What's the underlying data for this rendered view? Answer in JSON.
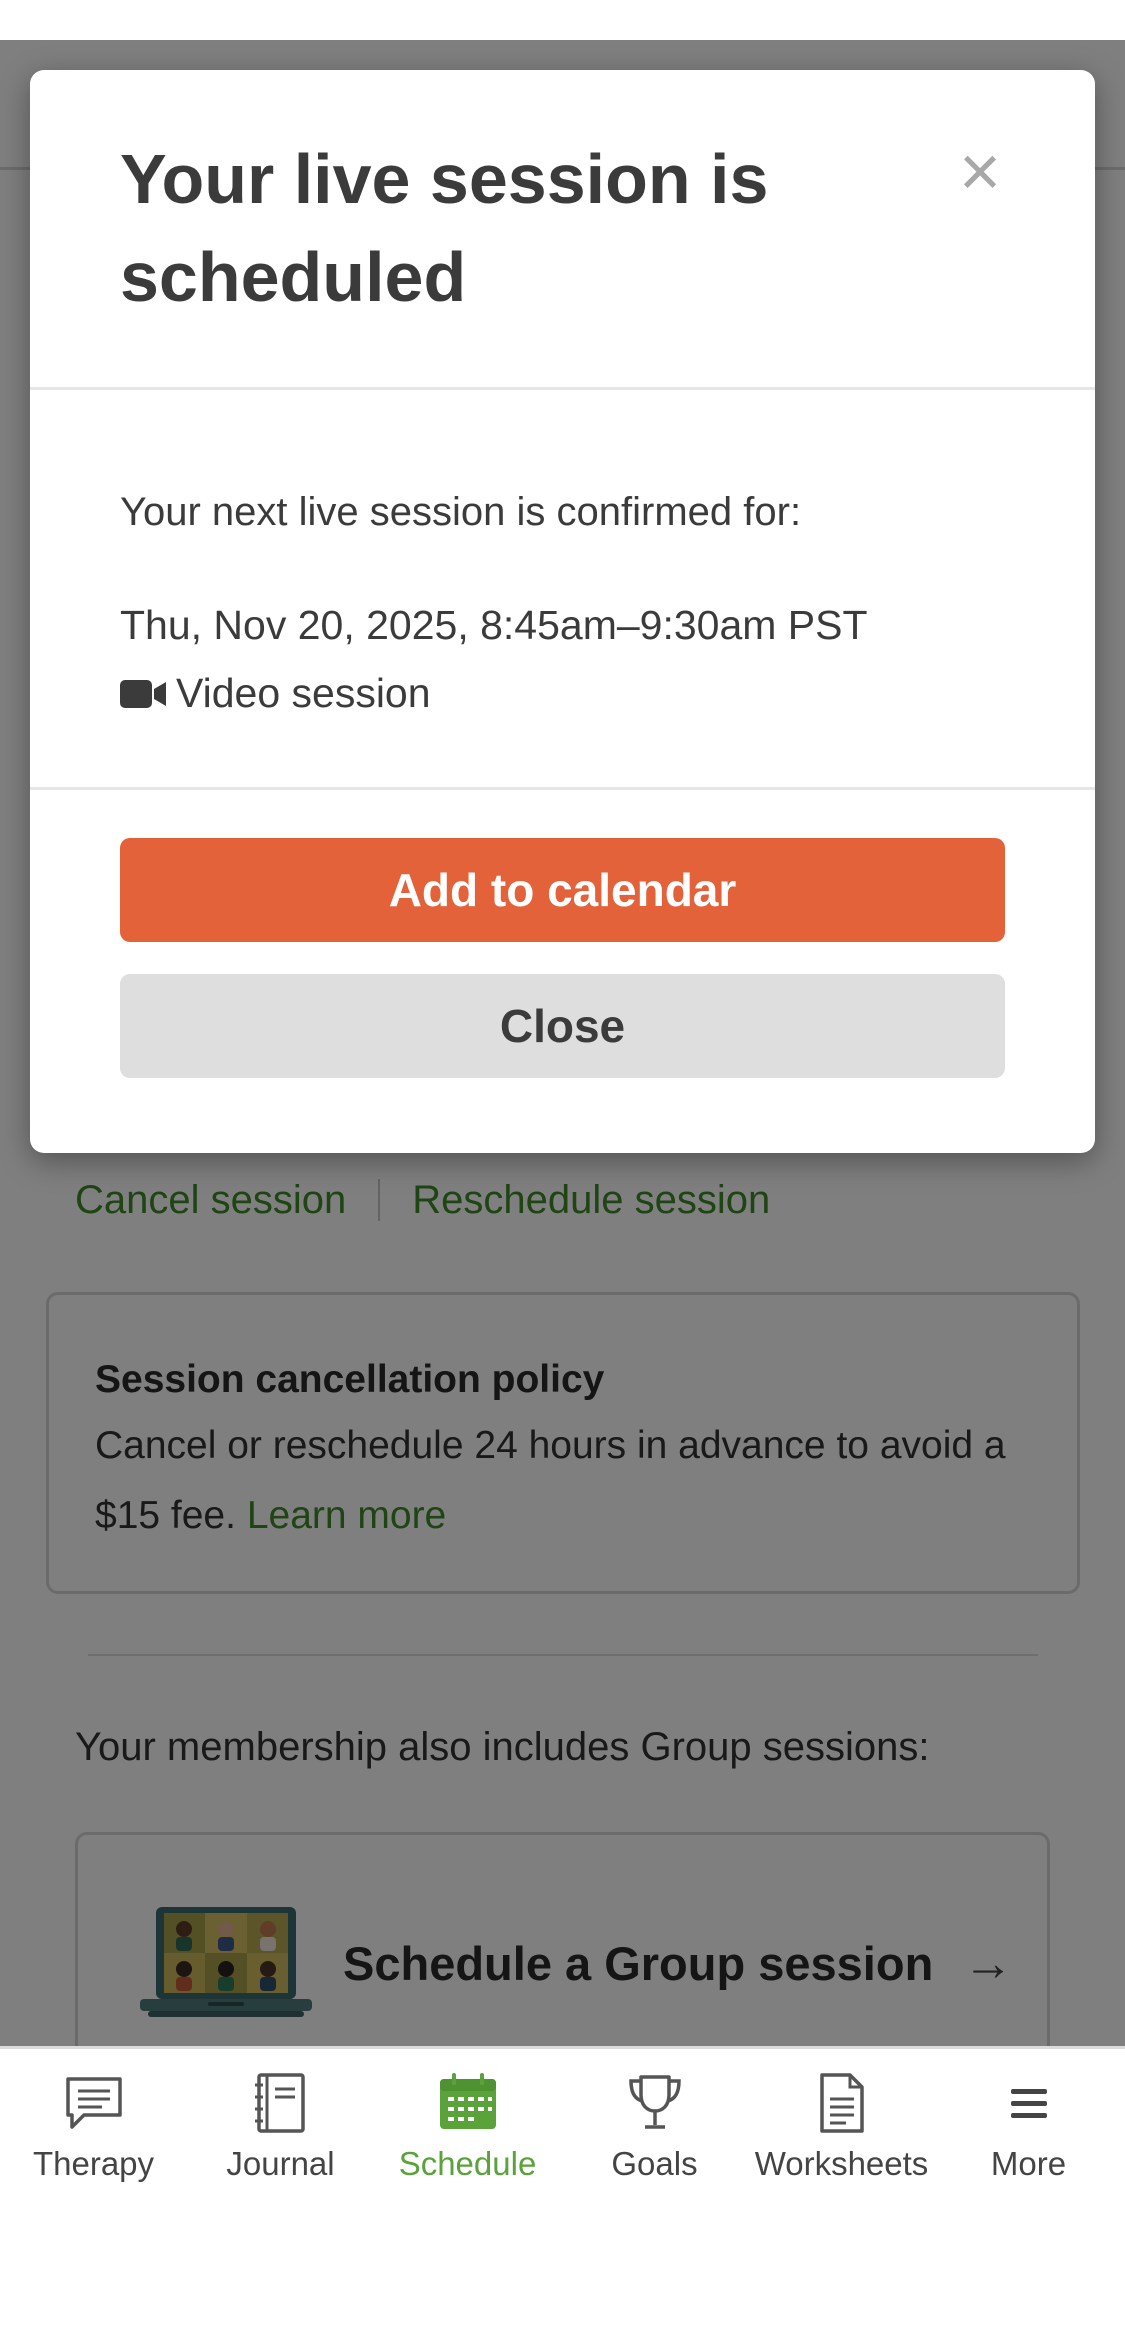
{
  "modal": {
    "title": "Your live session is scheduled",
    "close_symbol": "×",
    "confirm_label": "Your next live session is confirmed for:",
    "session_time": "Thu, Nov 20, 2025, 8:45am–9:30am PST",
    "session_type": "Video session",
    "session_type_icon": "video-camera-icon",
    "primary_button": "Add to calendar",
    "secondary_button": "Close"
  },
  "page": {
    "cancel_link": "Cancel session",
    "reschedule_link": "Reschedule session",
    "policy": {
      "title": "Session cancellation policy",
      "text": "Cancel or reschedule 24 hours in advance to avoid a $15 fee.",
      "link": "Learn more"
    },
    "membership_text": "Your membership also includes Group sessions:",
    "group_card": {
      "label": "Schedule a Group session",
      "arrow": "→",
      "illustration": "group-video-laptop-illustration"
    }
  },
  "nav": {
    "items": [
      {
        "label": "Therapy",
        "icon": "chat-bubble-icon"
      },
      {
        "label": "Journal",
        "icon": "notebook-icon"
      },
      {
        "label": "Schedule",
        "icon": "calendar-icon"
      },
      {
        "label": "Goals",
        "icon": "trophy-icon"
      },
      {
        "label": "Worksheets",
        "icon": "document-icon"
      },
      {
        "label": "More",
        "icon": "menu-icon"
      }
    ],
    "active": "Schedule"
  },
  "colors": {
    "accent_green": "#3f8a2a",
    "nav_active_green": "#5aa23a",
    "primary_button": "#e4623a",
    "secondary_button": "#dedede",
    "overlay": "rgba(0,0,0,0.5)"
  }
}
